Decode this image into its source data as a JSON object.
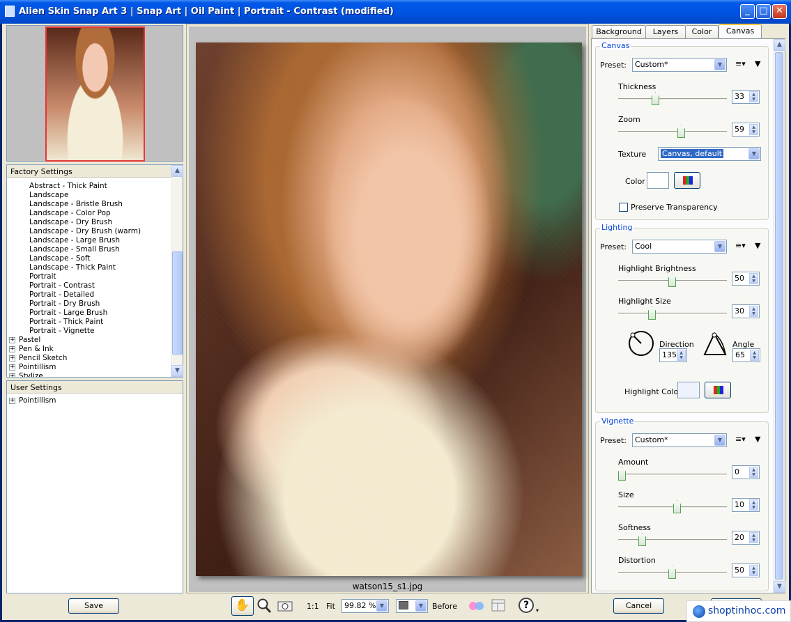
{
  "window": {
    "title": "Alien Skin Snap Art 3 | Snap Art | Oil Paint | Portrait - Contrast (modified)",
    "minimize": "_",
    "maximize": "□",
    "close": "✕"
  },
  "factory_settings": {
    "header": "Factory Settings",
    "items": [
      {
        "label": "Abstract - Thick Paint",
        "kind": "leaf"
      },
      {
        "label": "Landscape",
        "kind": "leaf"
      },
      {
        "label": "Landscape - Bristle Brush",
        "kind": "leaf"
      },
      {
        "label": "Landscape - Color Pop",
        "kind": "leaf"
      },
      {
        "label": "Landscape - Dry Brush",
        "kind": "leaf"
      },
      {
        "label": "Landscape - Dry Brush (warm)",
        "kind": "leaf"
      },
      {
        "label": "Landscape - Large Brush",
        "kind": "leaf"
      },
      {
        "label": "Landscape - Small Brush",
        "kind": "leaf"
      },
      {
        "label": "Landscape - Soft",
        "kind": "leaf"
      },
      {
        "label": "Landscape - Thick Paint",
        "kind": "leaf"
      },
      {
        "label": "Portrait",
        "kind": "leaf"
      },
      {
        "label": "Portrait - Contrast",
        "kind": "leaf"
      },
      {
        "label": "Portrait - Detailed",
        "kind": "leaf"
      },
      {
        "label": "Portrait - Dry Brush",
        "kind": "leaf"
      },
      {
        "label": "Portrait - Large Brush",
        "kind": "leaf"
      },
      {
        "label": "Portrait - Thick Paint",
        "kind": "leaf"
      },
      {
        "label": "Portrait - Vignette",
        "kind": "leaf"
      },
      {
        "label": "Pastel",
        "kind": "node"
      },
      {
        "label": "Pen & Ink",
        "kind": "node"
      },
      {
        "label": "Pencil Sketch",
        "kind": "node"
      },
      {
        "label": "Pointillism",
        "kind": "node"
      },
      {
        "label": "Stylize",
        "kind": "node"
      }
    ]
  },
  "user_settings": {
    "header": "User Settings",
    "items": [
      {
        "label": "Pointillism",
        "kind": "node"
      }
    ]
  },
  "preview": {
    "filename": "watson15_s1.jpg"
  },
  "tabs": [
    "Background",
    "Layers",
    "Color",
    "Canvas"
  ],
  "active_tab": "Canvas",
  "canvas": {
    "title": "Canvas",
    "preset_label": "Preset:",
    "preset_value": "Custom*",
    "thickness_label": "Thickness",
    "thickness_value": "33",
    "thickness_level": 0.33,
    "zoom_label": "Zoom",
    "zoom_value": "59",
    "zoom_level": 0.59,
    "texture_label": "Texture",
    "texture_value": "Canvas, default",
    "color_label": "Color",
    "preserve_label": "Preserve Transparency"
  },
  "lighting": {
    "title": "Lighting",
    "preset_label": "Preset:",
    "preset_value": "Cool",
    "brightness_label": "Highlight Brightness",
    "brightness_value": "50",
    "brightness_level": 0.5,
    "size_label": "Highlight Size",
    "size_value": "30",
    "size_level": 0.3,
    "direction_label": "Direction",
    "direction_value": "135",
    "angle_label": "Angle",
    "angle_value": "65",
    "color_label": "Highlight Color"
  },
  "vignette": {
    "title": "Vignette",
    "preset_label": "Preset:",
    "preset_value": "Custom*",
    "amount_label": "Amount",
    "amount_value": "0",
    "amount_level": 0.0,
    "size_label": "Size",
    "size_value": "10",
    "size_level": 0.55,
    "softness_label": "Softness",
    "softness_value": "20",
    "softness_level": 0.2,
    "distortion_label": "Distortion",
    "distortion_value": "50",
    "distortion_level": 0.5
  },
  "bottom": {
    "save": "Save",
    "one_to_one": "1:1",
    "fit": "Fit",
    "zoom_value": "99.82 %",
    "before": "Before",
    "cancel": "Cancel",
    "help": "?"
  },
  "watermark": "shoptinhoc.com"
}
